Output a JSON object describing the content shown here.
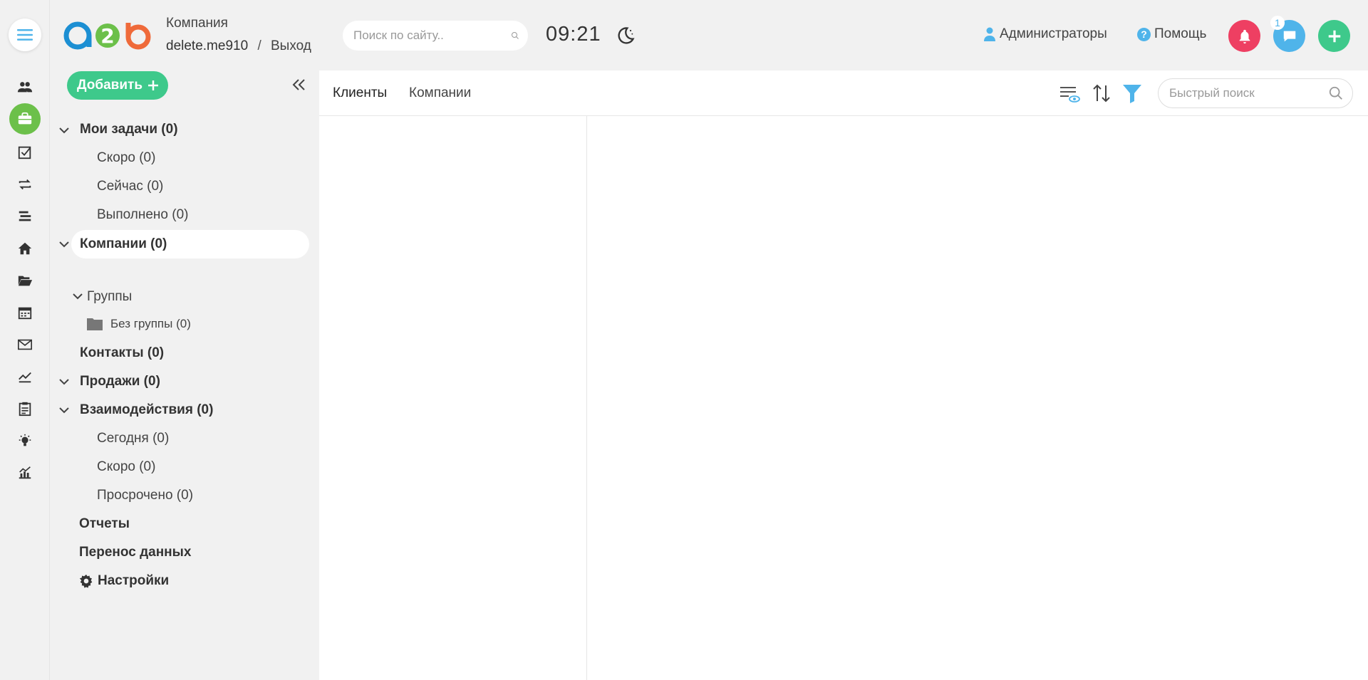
{
  "header": {
    "company_label": "Компания",
    "username": "delete.me910",
    "separator": "/",
    "logout": "Выход",
    "search_placeholder": "Поиск по сайту..",
    "time": "09:21",
    "admins": "Администраторы",
    "help": "Помощь",
    "chat_badge": "1"
  },
  "sidebar": {
    "add_button": "Добавить",
    "my_tasks": "Мои задачи (0)",
    "tasks_soon": "Скоро (0)",
    "tasks_now": "Сейчас (0)",
    "tasks_done": "Выполнено (0)",
    "companies": "Компании (0)",
    "groups": "Группы",
    "no_group": "Без группы (0)",
    "contacts": "Контакты (0)",
    "sales": "Продажи (0)",
    "interactions": "Взаимодействия (0)",
    "int_today": "Сегодня (0)",
    "int_soon": "Скоро (0)",
    "int_overdue": "Просрочено (0)",
    "reports": "Отчеты",
    "data_transfer": "Перенос данных",
    "settings": "Настройки"
  },
  "main": {
    "tabs": [
      {
        "label": "Клиенты",
        "active": true
      },
      {
        "label": "Компании",
        "active": false
      }
    ],
    "quick_search_placeholder": "Быстрый поиск"
  },
  "colors": {
    "green": "#6cc04a",
    "teal": "#3ec98b",
    "blue": "#4fb4ea",
    "red": "#ee3f62"
  }
}
